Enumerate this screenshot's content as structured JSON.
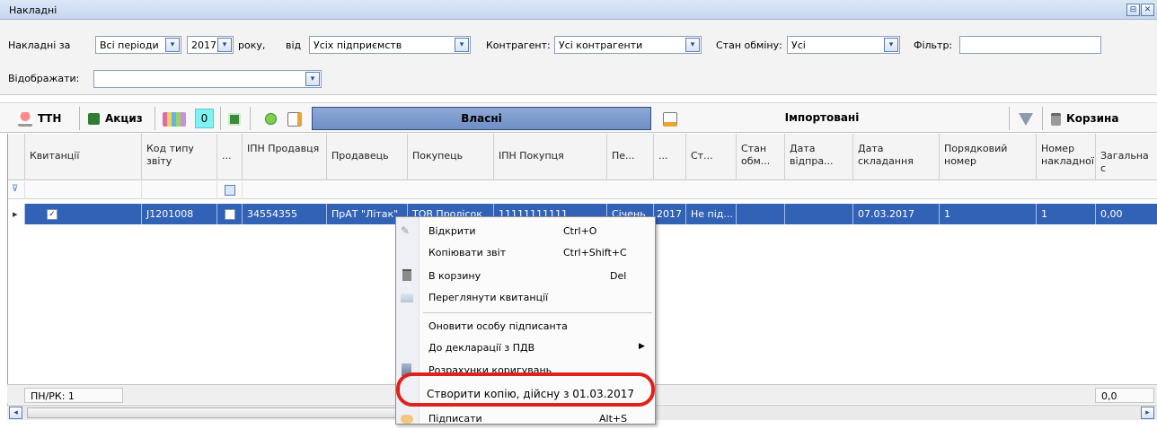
{
  "window": {
    "title": "Накладні"
  },
  "filters": {
    "invoices_for_label": "Накладні за",
    "period_value": "Всі періоди",
    "year_value": "2017",
    "year_suffix": "року,",
    "from_label": "від",
    "enterprise_value": "Усіх підприємств",
    "contractor_label": "Контрагент:",
    "contractor_value": "Усі контрагенти",
    "exchange_state_label": "Стан обміну:",
    "exchange_state_value": "Усі",
    "filter_label": "Фільтр:",
    "filter_value": "",
    "display_label": "Відображати:",
    "display_value": ""
  },
  "toolbar": {
    "ttn_label": "ТТН",
    "excise_label": "Акциз",
    "count_value": "0",
    "own_tab_label": "Власні",
    "imported_tab_label": "Імпортовані",
    "trash_label": "Корзина"
  },
  "grid": {
    "columns": [
      "Квитанції",
      "Код типу звіту",
      "...",
      "ІПН Продавця",
      "Продавець",
      "Покупець",
      "ІПН Покупця",
      "Пе...",
      "...",
      "Ст...",
      "Стан обм...",
      "Дата відпра...",
      "Дата складання",
      "Порядковий номер",
      "Номер накладної",
      "Загальна с"
    ],
    "row": {
      "report_type_code": "J1201008",
      "seller_ipn": "34554355",
      "seller": "ПрАТ \"Літак\"",
      "buyer": "ТОВ Пролісок",
      "buyer_ipn": "11111111111",
      "period": "Січень",
      "year": "2017",
      "status": "Не під...",
      "date_compiled": "07.03.2017",
      "serial_number": "1",
      "invoice_number": "1",
      "total": "0,00"
    }
  },
  "footer": {
    "count_label": "ПН/РК: 1",
    "total_value": "0,0"
  },
  "context_menu": {
    "items": [
      {
        "label": "Відкрити",
        "shortcut": "Ctrl+O"
      },
      {
        "label": "Копіювати звіт",
        "shortcut": "Ctrl+Shift+C"
      },
      {
        "label": "В корзину",
        "shortcut": "Del"
      },
      {
        "label": "Переглянути квитанції",
        "shortcut": ""
      },
      {
        "label": "Оновити особу підписанта",
        "shortcut": ""
      },
      {
        "label": "До декларації з ПДВ",
        "shortcut": ""
      },
      {
        "label": "Розрахунки коригувань",
        "shortcut": ""
      },
      {
        "label": "Створити копію, дійсну з 01.03.2017",
        "shortcut": ""
      },
      {
        "label": "Підписати",
        "shortcut": "Alt+S"
      }
    ]
  },
  "colors": {
    "selection": "#3262b5",
    "own_tab": "#7b98cc",
    "highlight_ring": "#e0221c"
  }
}
